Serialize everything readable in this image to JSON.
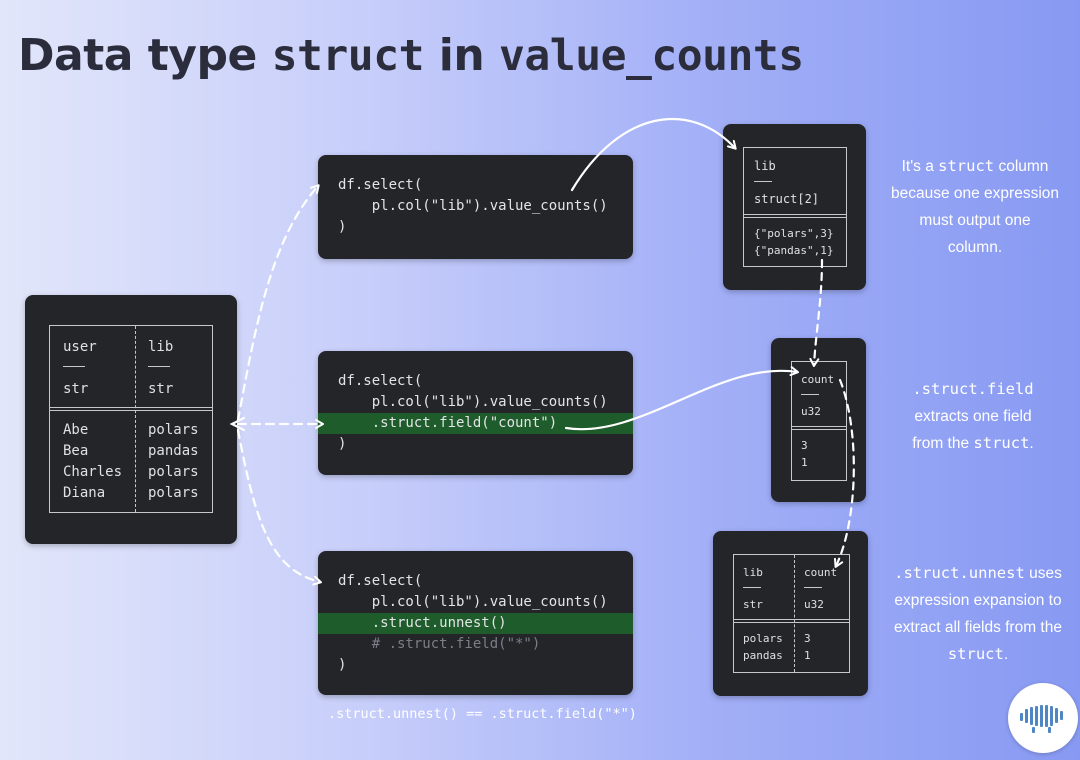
{
  "title": {
    "prefix": "Data type ",
    "code1": "struct",
    "mid": " in ",
    "code2": "value_counts"
  },
  "source_table": {
    "headers": [
      "user",
      "lib"
    ],
    "dtypes": [
      "str",
      "str"
    ],
    "rows": [
      [
        "Abe",
        "polars"
      ],
      [
        "Bea",
        "pandas"
      ],
      [
        "Charles",
        "polars"
      ],
      [
        "Diana",
        "polars"
      ]
    ]
  },
  "code_blocks": [
    {
      "lines": [
        "df.select(",
        "    pl.col(\"lib\").value_counts()",
        ")"
      ]
    },
    {
      "lines": [
        "df.select(",
        "    pl.col(\"lib\").value_counts()",
        "    .struct.field(\"count\")",
        ")"
      ]
    },
    {
      "lines": [
        "df.select(",
        "    pl.col(\"lib\").value_counts()",
        "    .struct.unnest()",
        "    # .struct.field(\"*\")",
        ")"
      ]
    }
  ],
  "result_struct": {
    "header": "lib",
    "dtype": "struct[2]",
    "values": [
      "{\"polars\",3}",
      "{\"pandas\",1}"
    ]
  },
  "result_field": {
    "header": "count",
    "dtype": "u32",
    "values": [
      "3",
      "1"
    ]
  },
  "result_unnest": {
    "headers": [
      "lib",
      "count"
    ],
    "dtypes": [
      "str",
      "u32"
    ],
    "rows": [
      [
        "polars",
        "3"
      ],
      [
        "pandas",
        "1"
      ]
    ]
  },
  "notes": {
    "n1": {
      "a": "It's a ",
      "b": "struct",
      "c": " column",
      "d": "because one expression",
      "e": "must output one",
      "f": "column."
    },
    "n2": {
      "a": ".struct.field",
      "b": "extracts one field",
      "c": "from the ",
      "d": "struct",
      "e": "."
    },
    "n3": {
      "a": ".struct.unnest",
      "b": " uses",
      "c": "expression expansion to",
      "d": "extract all fields from the",
      "e": "struct",
      "f": "."
    }
  },
  "bottom_note": ".struct.unnest() == .struct.field(\"*\")",
  "logo_icon": "polar-bear-logo-icon"
}
